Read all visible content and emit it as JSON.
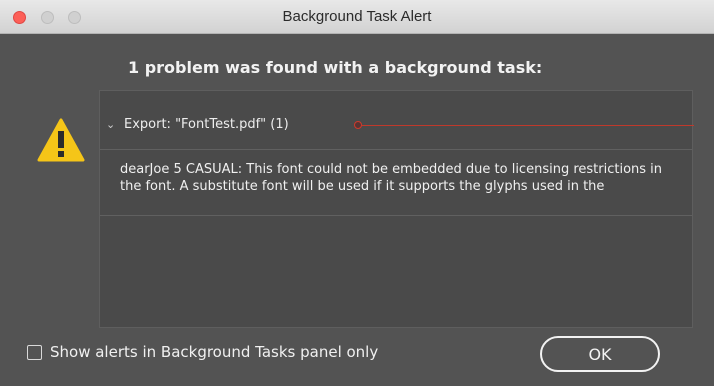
{
  "window": {
    "title": "Background Task Alert"
  },
  "heading": "1 problem was found with a background task:",
  "task": {
    "label": "Export: \"FontTest.pdf\" (1)",
    "expanded": true
  },
  "message": "dearJoe 5 CASUAL: This font could not be embedded due to licensing restrictions in the font. A substitute font will be used if it supports the glyphs used in the",
  "footer": {
    "checkbox_label": "Show alerts in Background Tasks panel only",
    "checkbox_checked": false,
    "ok_label": "OK"
  },
  "icons": {
    "warning": "warning-icon",
    "chevron": "chevron-down-icon"
  },
  "colors": {
    "window_bg": "#535353",
    "panel_bg": "#4a4a4a",
    "warning_yellow": "#f5c518",
    "annotation_red": "#c0392b",
    "close_button": "#fc5f57"
  }
}
